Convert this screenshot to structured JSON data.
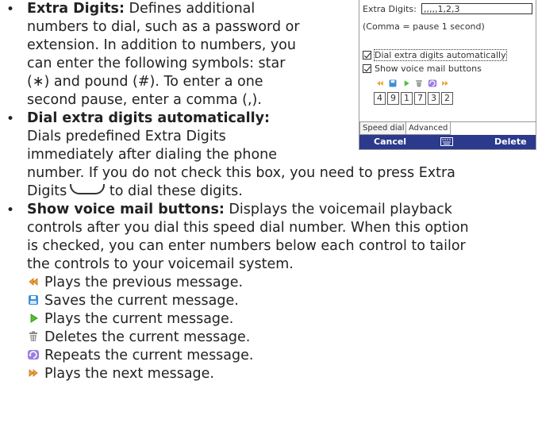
{
  "device": {
    "extra_digits_label": "Extra Digits:",
    "extra_digits_value": ",,,,,1,2,3",
    "comma_note": "(Comma = pause 1 second)",
    "dial_auto_label": "Dial extra digits automatically",
    "show_vm_label": "Show voice mail buttons",
    "digits": [
      "4",
      "9",
      "1",
      "7",
      "3",
      "2"
    ],
    "tabs": [
      "Speed dial",
      "Advanced"
    ],
    "soft_left": "Cancel",
    "soft_right": "Delete",
    "soft_middle_icon": "keyboard-icon"
  },
  "bullets": {
    "b1_title": "Extra Digits:",
    "b1_l1": " Defines additional",
    "b1_l2": "numbers to dial, such as a password or",
    "b1_l3": "extension. In addition to numbers, you",
    "b1_l4": "can enter the following symbols: star",
    "b1_l5": "(∗) and pound (#). To enter a one",
    "b1_l6": "second pause, enter a comma (,).",
    "b2_title": "Dial extra digits automatically:",
    "b2_l1": "Dials predefined Extra Digits",
    "b2_l2": "immediately after dialing the phone",
    "b2_l3": "number. If you do not check this box, you need to press Extra",
    "b2_l4": "Digits",
    "b2_l4b": " to dial these digits.",
    "b3_title": "Show voice mail buttons:",
    "b3_l1": " Displays the voicemail playback",
    "b3_l2": "controls after you dial this speed dial number. When this option",
    "b3_l3": "is checked, you can enter numbers below each control to tailor",
    "b3_l4": "the controls to your voicemail system."
  },
  "controls": [
    {
      "icon": "previous-message-icon",
      "text": "Plays the previous message."
    },
    {
      "icon": "save-message-icon",
      "text": "Saves the current message."
    },
    {
      "icon": "play-message-icon",
      "text": "Plays the current message."
    },
    {
      "icon": "delete-message-icon",
      "text": "Deletes the current message."
    },
    {
      "icon": "repeat-message-icon",
      "text": "Repeats the current message."
    },
    {
      "icon": "next-message-icon",
      "text": "Plays the next message."
    }
  ]
}
